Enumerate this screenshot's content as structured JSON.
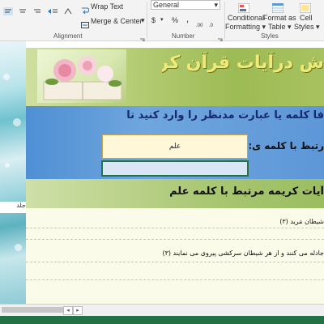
{
  "ribbon": {
    "wrap_text": "Wrap Text",
    "merge_center": "Merge & Center",
    "number_format": "General",
    "alignment_group": "Alignment",
    "number_group": "Number",
    "styles_group": "Styles",
    "conditional_formatting": [
      "Conditional",
      "Formatting ▾"
    ],
    "format_as_table": [
      "Format as",
      "Table ▾"
    ],
    "cell_styles": [
      "Cell",
      "Styles ▾"
    ],
    "currency_symbol": "$",
    "percent_symbol": "%",
    "comma_symbol": ","
  },
  "sheet": {
    "title": "ش درآیات قرآن کریم",
    "instruction": "فا کلمه یا عبارت مدنظر را وارد کنید تا",
    "word_label": "رتبط با کلمه ی:",
    "search_value": "علم",
    "results_title": "آیات کریمه مرتبط با کلمه علم",
    "results": [
      "شیطان مَرید (۳)",
      "جادله می کنند و از هر شیطان سرکشی پیروی می نمایند (۳)"
    ],
    "left_caption": "جلد"
  },
  "colors": {
    "excel_green": "#217346",
    "title_yellow": "#f2ea78",
    "band_green": "#9dbb55",
    "blue_band": "#4f8fd3",
    "input_fill": "#fff7d8"
  }
}
